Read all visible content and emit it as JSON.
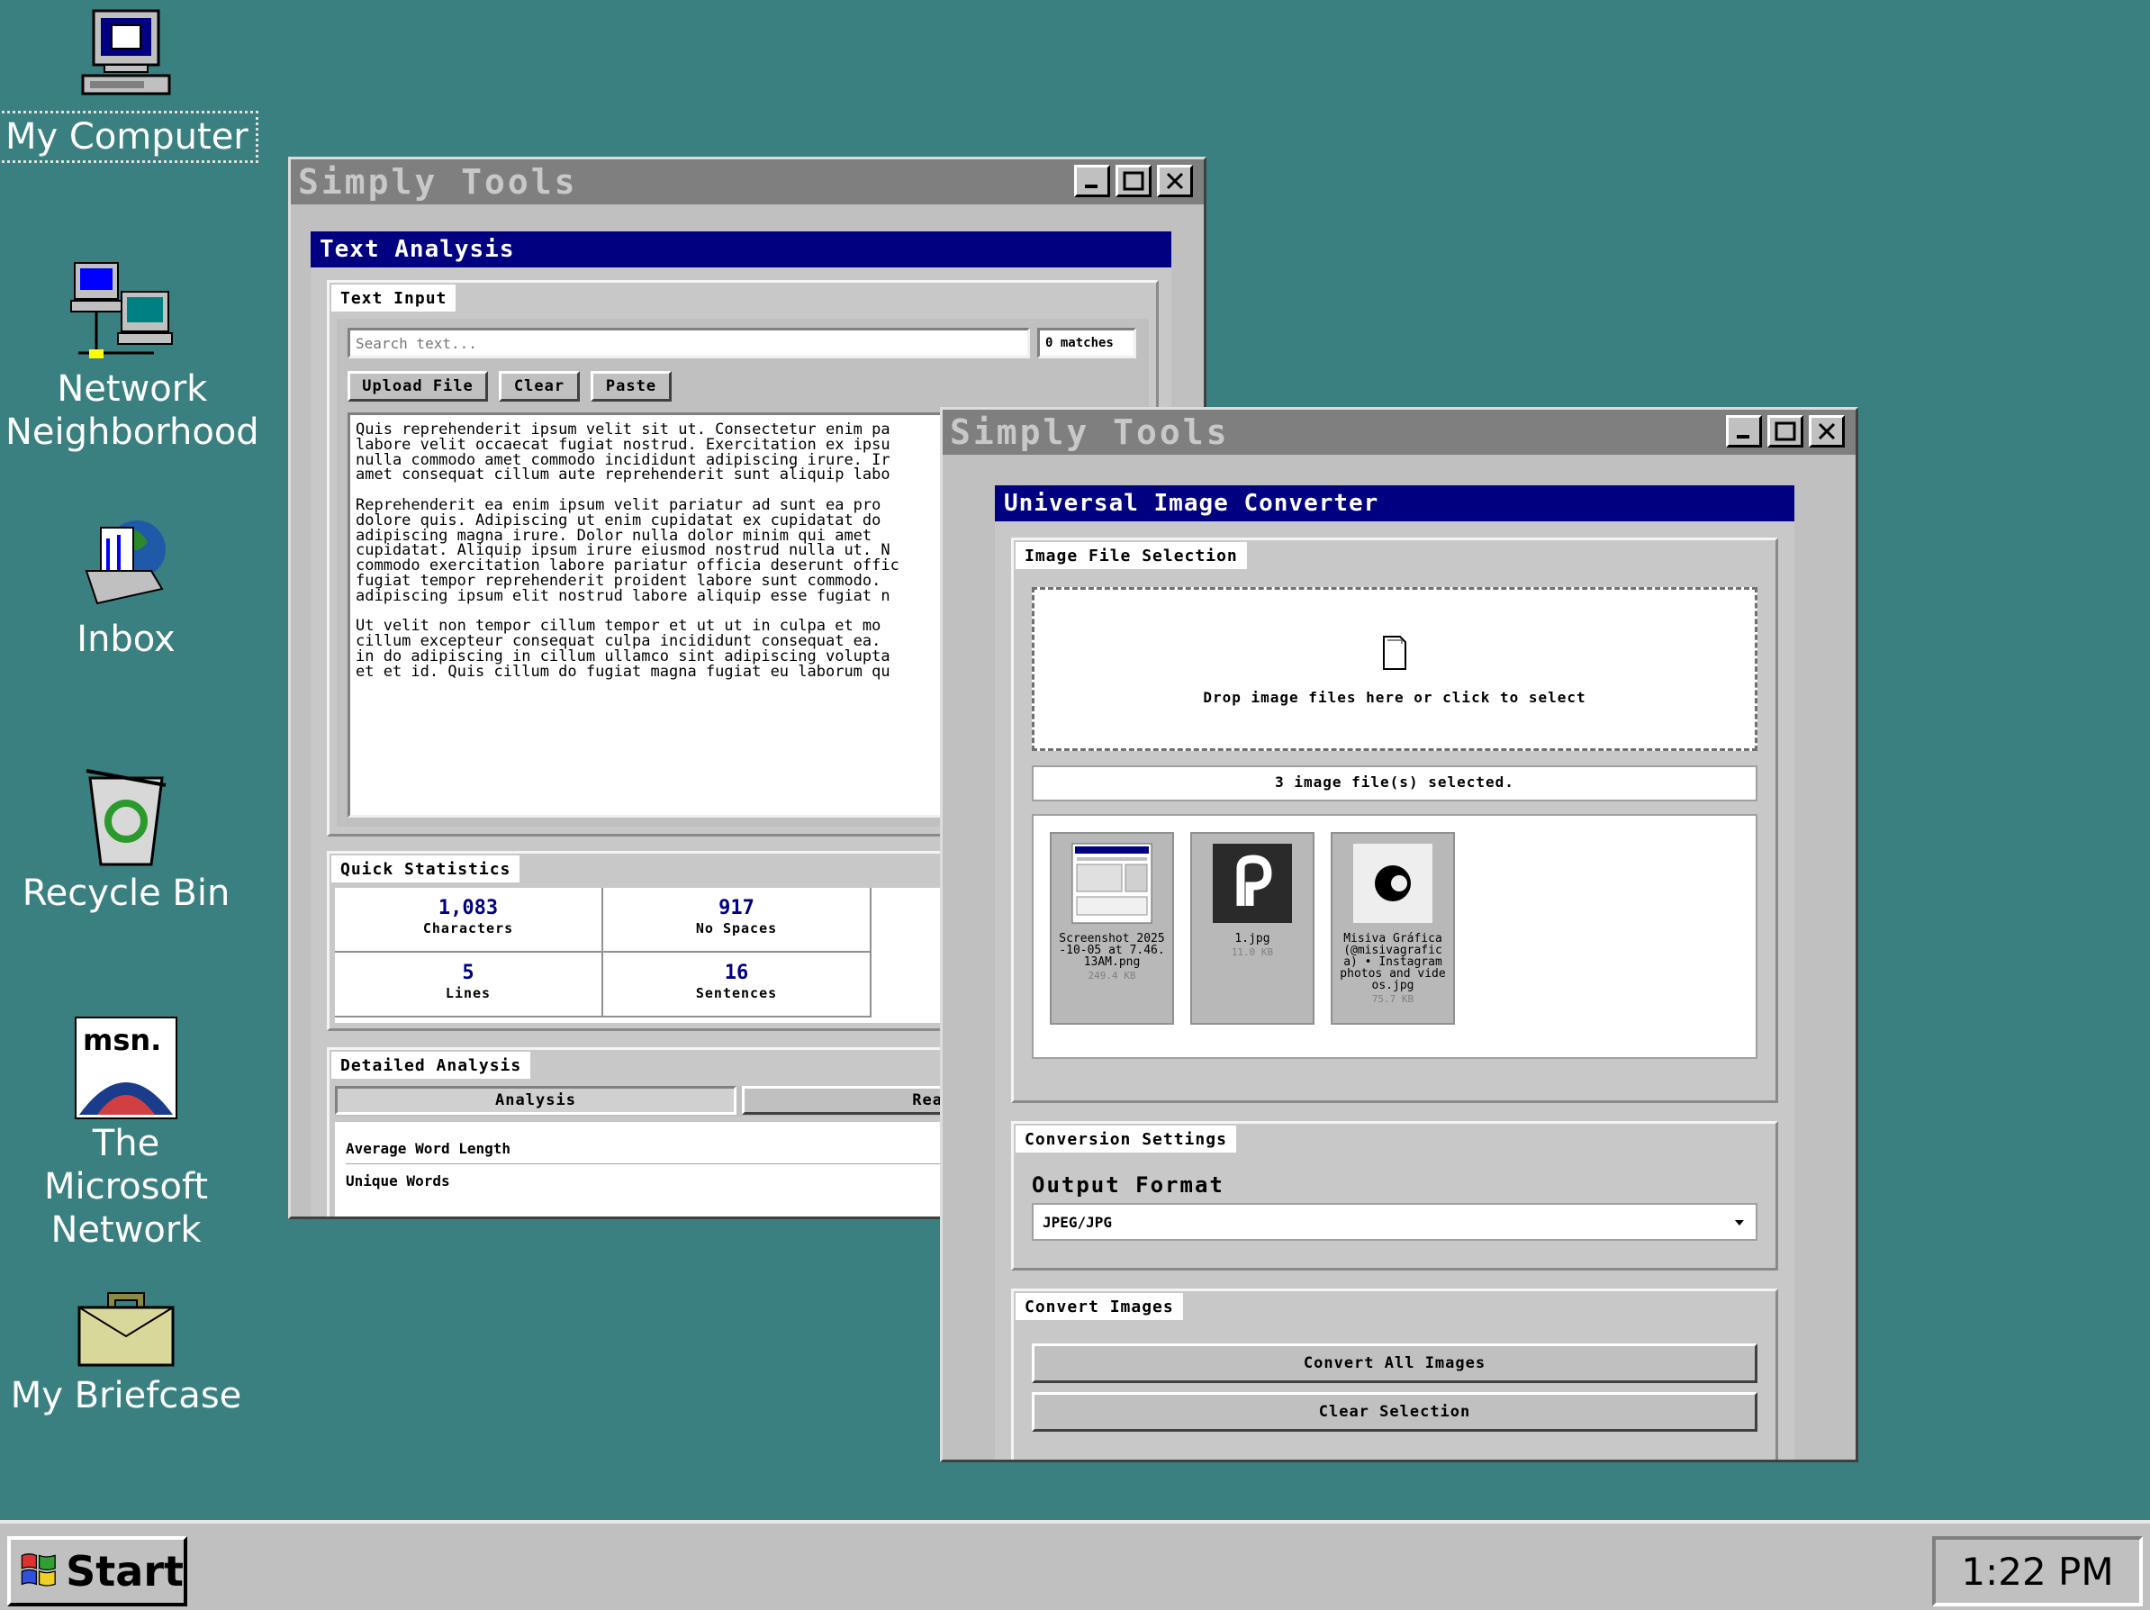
{
  "desktop": {
    "icons": [
      {
        "label": "My Computer"
      },
      {
        "label": "Network\nNeighborhood"
      },
      {
        "label": "Inbox"
      },
      {
        "label": "Recycle Bin"
      },
      {
        "label": "The Microsoft\nNetwork"
      },
      {
        "label": "My Briefcase"
      }
    ]
  },
  "text_window": {
    "title": "Simply Tools",
    "header": "Text Analysis",
    "input_section": {
      "tab": "Text Input",
      "search_placeholder": "Search text...",
      "matches": "0 matches",
      "upload_label": "Upload File",
      "clear_label": "Clear",
      "paste_label": "Paste",
      "text": "Quis reprehenderit ipsum velit sit ut. Consectetur enim pa\nlabore velit occaecat fugiat nostrud. Exercitation ex ipsu\nnulla commodo amet commodo incididunt adipiscing irure. Ir\namet consequat cillum aute reprehenderit sunt aliquip labo\n\nReprehenderit ea enim ipsum velit pariatur ad sunt ea pro\ndolore quis. Adipiscing ut enim cupidatat ex cupidatat do\nadipiscing magna irure. Dolor nulla dolor minim qui amet \ncupidatat. Aliquip ipsum irure eiusmod nostrud nulla ut. N\ncommodo exercitation labore pariatur officia deserunt offic\nfugiat tempor reprehenderit proident labore sunt commodo. \nadipiscing ipsum elit nostrud labore aliquip esse fugiat n\n\nUt velit non tempor cillum tempor et ut ut in culpa et mo\ncillum excepteur consequat culpa incididunt consequat ea. \nin do adipiscing in cillum ullamco sint adipiscing volupta\net et id. Quis cillum do fugiat magna fugiat eu laborum qu"
    },
    "stats_section": {
      "tab": "Quick Statistics",
      "cells": [
        {
          "value": "1,083",
          "caption": "Characters"
        },
        {
          "value": "917",
          "caption": "No Spaces"
        },
        {
          "value": "5",
          "caption": "Lines"
        },
        {
          "value": "16",
          "caption": "Sentences"
        }
      ]
    },
    "detail_section": {
      "tab": "Detailed Analysis",
      "subtabs": [
        "Analysis",
        "Readin"
      ],
      "rows": [
        "Average Word Length",
        "Unique Words"
      ]
    }
  },
  "image_window": {
    "title": "Simply Tools",
    "header": "Universal Image Converter",
    "file_section": {
      "tab": "Image File Selection",
      "drop_text": "Drop image files here or click to select",
      "selected_text": "3 image file(s) selected.",
      "files": [
        {
          "name": "Screenshot 2025-10-05 at 7.46.13AM.png",
          "size": "249.4 KB"
        },
        {
          "name": "1.jpg",
          "size": "11.0 KB"
        },
        {
          "name": "Misiva Gráfica (@misivagrafica) • Instagram photos and videos.jpg",
          "size": "75.7 KB"
        }
      ]
    },
    "settings_section": {
      "tab": "Conversion Settings",
      "label": "Output Format",
      "selected": "JPEG/JPG"
    },
    "convert_section": {
      "tab": "Convert Images",
      "convert_label": "Convert All Images",
      "clear_label": "Clear Selection"
    }
  },
  "taskbar": {
    "start_label": "Start",
    "clock": "1:22 PM"
  }
}
